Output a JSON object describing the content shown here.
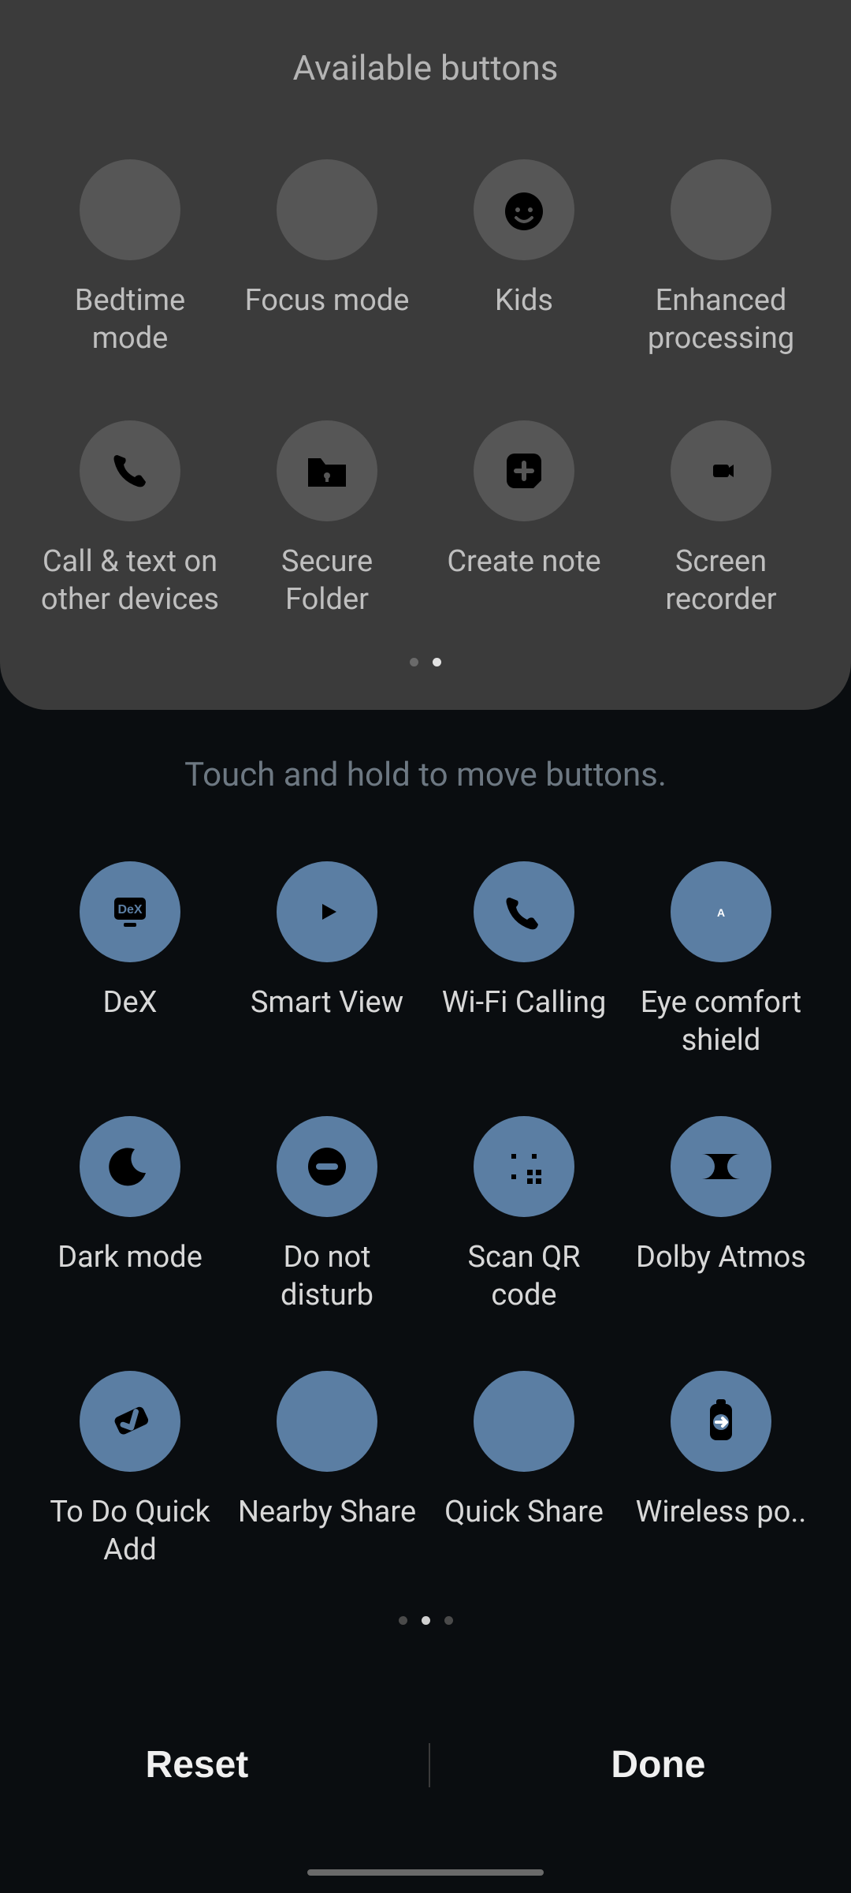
{
  "panel": {
    "title": "Available buttons",
    "page_count": 2,
    "page_active_index": 1,
    "items": [
      {
        "id": "bedtime-mode",
        "label": "Bedtime mode",
        "icon": "bed-icon"
      },
      {
        "id": "focus-mode",
        "label": "Focus mode",
        "icon": "target-icon"
      },
      {
        "id": "kids",
        "label": "Kids",
        "icon": "kid-face-icon"
      },
      {
        "id": "enhanced-proc",
        "label": "Enhanced processing",
        "icon": "gauge-icon"
      },
      {
        "id": "call-text",
        "label": "Call & text on other devices",
        "icon": "phone-sync-icon"
      },
      {
        "id": "secure-folder",
        "label": "Secure Folder",
        "icon": "lock-folder-icon"
      },
      {
        "id": "create-note",
        "label": "Create note",
        "icon": "note-plus-icon"
      },
      {
        "id": "screen-rec",
        "label": "Screen recorder",
        "icon": "record-frame-icon"
      }
    ]
  },
  "hint": "Touch and hold to move buttons.",
  "active_panel": {
    "page_count": 3,
    "page_active_index": 1,
    "items": [
      {
        "id": "dex",
        "label": "DeX",
        "icon": "dex-icon"
      },
      {
        "id": "smart-view",
        "label": "Smart View",
        "icon": "smart-view-icon"
      },
      {
        "id": "wifi-calling",
        "label": "Wi-Fi Calling",
        "icon": "wifi-call-icon"
      },
      {
        "id": "eye-comfort",
        "label": "Eye comfort shield",
        "icon": "eye-comfort-icon"
      },
      {
        "id": "dark-mode",
        "label": "Dark mode",
        "icon": "moon-icon"
      },
      {
        "id": "dnd",
        "label": "Do not disturb",
        "icon": "dnd-icon"
      },
      {
        "id": "scan-qr",
        "label": "Scan QR code",
        "icon": "qr-icon"
      },
      {
        "id": "dolby",
        "label": "Dolby Atmos",
        "icon": "dolby-icon"
      },
      {
        "id": "todo-quick",
        "label": "To Do Quick Add",
        "icon": "check-icon"
      },
      {
        "id": "nearby-share",
        "label": "Nearby Share",
        "icon": "nearby-icon"
      },
      {
        "id": "quick-share",
        "label": "Quick Share",
        "icon": "quick-share-icon"
      },
      {
        "id": "wireless-power",
        "label": "Wireless po..",
        "icon": "battery-share-icon",
        "truncated": true
      }
    ]
  },
  "footer": {
    "reset": "Reset",
    "done": "Done"
  },
  "colors": {
    "available_circle": "#565656",
    "active_circle": "#5b7ea3",
    "panel_bg": "#3b3b3b",
    "body_bg": "#0a0d10"
  }
}
